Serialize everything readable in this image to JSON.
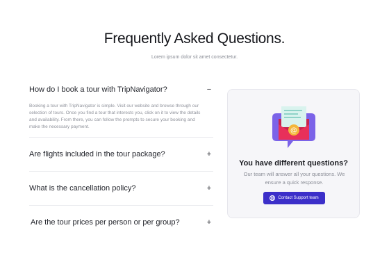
{
  "header": {
    "title": "Frequently Asked Questions.",
    "subtitle": "Lorem ipsum dolor sit amet consectetur."
  },
  "faq": {
    "items": [
      {
        "question": "How do I book a tour with TripNavigator?",
        "toggle": "−",
        "answer": "Booking a tour with TripNavigator is simple. Visit our website and browse through our selection of tours. Once you find a tour that interests you, click on it to view the details and availability. From there, you can follow the prompts to secure your booking and make the necessary payment.",
        "expanded": true
      },
      {
        "question": "Are flights included in the tour package?",
        "toggle": "+",
        "expanded": false
      },
      {
        "question": "What is the cancellation policy?",
        "toggle": "+",
        "expanded": false
      },
      {
        "question": "Are the tour prices per person or per group?",
        "toggle": "+",
        "expanded": false
      }
    ]
  },
  "support": {
    "title": "You have different questions?",
    "text": "Our team will answer all your questions. We ensure a quick response.",
    "button_label": "Contact Support team",
    "button_icon": "support-icon",
    "illustration_icon": "mail-chat-icon"
  },
  "colors": {
    "accent": "#3c2fc9",
    "bubble": "#7b63e8",
    "envelope": "#e8305a",
    "letter": "#d9f3ee",
    "at_badge": "#f4b73a"
  }
}
